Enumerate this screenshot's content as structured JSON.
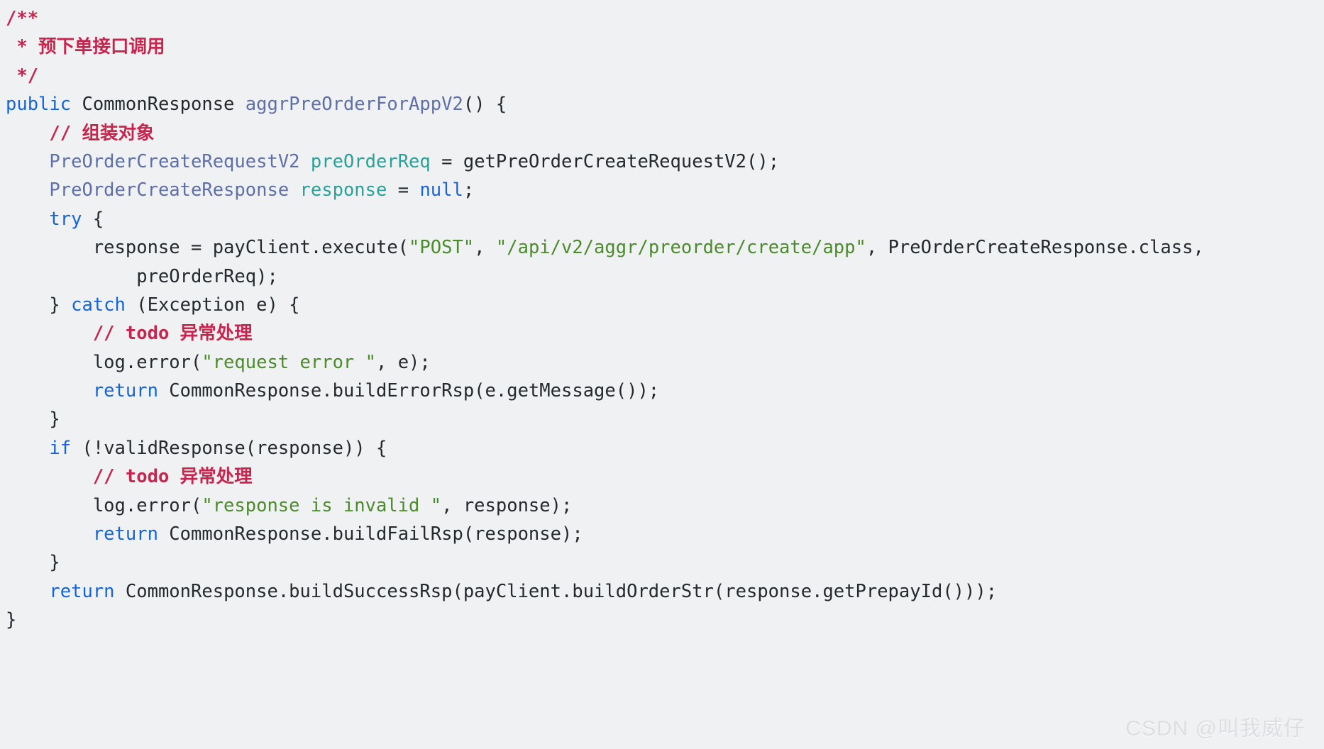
{
  "editor": {
    "background_color": "#eff1f3",
    "language": "java",
    "theme_colors": {
      "plain": "#24292e",
      "keyword": "#1565d8",
      "comment": "#c7254e",
      "type": "#5f6fa8",
      "field": "#2aa198",
      "string": "#4c8b2b"
    }
  },
  "code": {
    "lines": [
      {
        "id": "line-1",
        "tokens": [
          {
            "t": "comment",
            "s": "/**"
          }
        ]
      },
      {
        "id": "line-2",
        "tokens": [
          {
            "t": "comment",
            "s": " * 预下单接口调用"
          }
        ]
      },
      {
        "id": "line-3",
        "tokens": [
          {
            "t": "comment",
            "s": " */"
          }
        ]
      },
      {
        "id": "line-4",
        "tokens": [
          {
            "t": "keyword",
            "s": "public"
          },
          {
            "t": "plain",
            "s": " CommonResponse "
          },
          {
            "t": "type",
            "s": "aggrPreOrderForAppV2"
          },
          {
            "t": "plain",
            "s": "() {"
          }
        ]
      },
      {
        "id": "line-5",
        "tokens": [
          {
            "t": "plain",
            "s": "    "
          },
          {
            "t": "comment",
            "s": "// 组装对象"
          }
        ]
      },
      {
        "id": "line-6",
        "tokens": [
          {
            "t": "plain",
            "s": "    "
          },
          {
            "t": "type",
            "s": "PreOrderCreateRequestV2"
          },
          {
            "t": "plain",
            "s": " "
          },
          {
            "t": "field",
            "s": "preOrderReq"
          },
          {
            "t": "plain",
            "s": " = getPreOrderCreateRequestV2();"
          }
        ]
      },
      {
        "id": "line-7",
        "tokens": [
          {
            "t": "plain",
            "s": "    "
          },
          {
            "t": "type",
            "s": "PreOrderCreateResponse"
          },
          {
            "t": "plain",
            "s": " "
          },
          {
            "t": "field",
            "s": "response"
          },
          {
            "t": "plain",
            "s": " = "
          },
          {
            "t": "keyword",
            "s": "null"
          },
          {
            "t": "plain",
            "s": ";"
          }
        ]
      },
      {
        "id": "line-8",
        "tokens": [
          {
            "t": "plain",
            "s": "    "
          },
          {
            "t": "keyword",
            "s": "try"
          },
          {
            "t": "plain",
            "s": " {"
          }
        ]
      },
      {
        "id": "line-9",
        "tokens": [
          {
            "t": "plain",
            "s": "        response = payClient.execute("
          },
          {
            "t": "string",
            "s": "\"POST\""
          },
          {
            "t": "plain",
            "s": ", "
          },
          {
            "t": "string",
            "s": "\"/api/v2/aggr/preorder/create/app\""
          },
          {
            "t": "plain",
            "s": ", PreOrderCreateResponse.class,"
          }
        ]
      },
      {
        "id": "line-10",
        "tokens": [
          {
            "t": "plain",
            "s": "            preOrderReq);"
          }
        ]
      },
      {
        "id": "line-11",
        "tokens": [
          {
            "t": "plain",
            "s": "    } "
          },
          {
            "t": "keyword",
            "s": "catch"
          },
          {
            "t": "plain",
            "s": " (Exception e) {"
          }
        ]
      },
      {
        "id": "line-12",
        "tokens": [
          {
            "t": "plain",
            "s": "        "
          },
          {
            "t": "comment",
            "s": "// todo 异常处理"
          }
        ]
      },
      {
        "id": "line-13",
        "tokens": [
          {
            "t": "plain",
            "s": "        log.error("
          },
          {
            "t": "string",
            "s": "\"request error \""
          },
          {
            "t": "plain",
            "s": ", e);"
          }
        ]
      },
      {
        "id": "line-14",
        "tokens": [
          {
            "t": "plain",
            "s": "        "
          },
          {
            "t": "keyword",
            "s": "return"
          },
          {
            "t": "plain",
            "s": " CommonResponse.buildErrorRsp(e.getMessage());"
          }
        ]
      },
      {
        "id": "line-15",
        "tokens": [
          {
            "t": "plain",
            "s": "    }"
          }
        ]
      },
      {
        "id": "line-16",
        "tokens": [
          {
            "t": "plain",
            "s": "    "
          },
          {
            "t": "keyword",
            "s": "if"
          },
          {
            "t": "plain",
            "s": " (!validResponse(response)) {"
          }
        ]
      },
      {
        "id": "line-17",
        "tokens": [
          {
            "t": "plain",
            "s": "        "
          },
          {
            "t": "comment",
            "s": "// todo 异常处理"
          }
        ]
      },
      {
        "id": "line-18",
        "tokens": [
          {
            "t": "plain",
            "s": "        log.error("
          },
          {
            "t": "string",
            "s": "\"response is invalid \""
          },
          {
            "t": "plain",
            "s": ", response);"
          }
        ]
      },
      {
        "id": "line-19",
        "tokens": [
          {
            "t": "plain",
            "s": "        "
          },
          {
            "t": "keyword",
            "s": "return"
          },
          {
            "t": "plain",
            "s": " CommonResponse.buildFailRsp(response);"
          }
        ]
      },
      {
        "id": "line-20",
        "tokens": [
          {
            "t": "plain",
            "s": "    }"
          }
        ]
      },
      {
        "id": "line-21",
        "tokens": [
          {
            "t": "plain",
            "s": "    "
          },
          {
            "t": "keyword",
            "s": "return"
          },
          {
            "t": "plain",
            "s": " CommonResponse.buildSuccessRsp(payClient.buildOrderStr(response.getPrepayId()));"
          }
        ]
      },
      {
        "id": "line-22",
        "tokens": [
          {
            "t": "plain",
            "s": "}"
          }
        ]
      }
    ]
  },
  "watermark": {
    "text": "CSDN @叫我威仔"
  }
}
